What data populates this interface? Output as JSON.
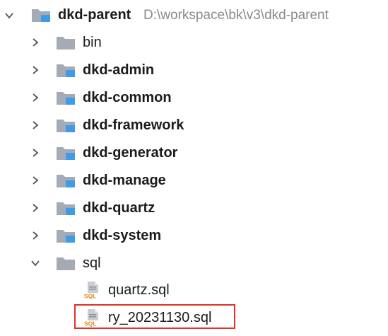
{
  "root": {
    "name": "dkd-parent",
    "path": "D:\\workspace\\bk\\v3\\dkd-parent"
  },
  "items": [
    {
      "label": "bin"
    },
    {
      "label": "dkd-admin"
    },
    {
      "label": "dkd-common"
    },
    {
      "label": "dkd-framework"
    },
    {
      "label": "dkd-generator"
    },
    {
      "label": "dkd-manage"
    },
    {
      "label": "dkd-quartz"
    },
    {
      "label": "dkd-system"
    },
    {
      "label": "sql"
    }
  ],
  "sql_files": [
    {
      "label": "quartz.sql",
      "icon_text": "SQL"
    },
    {
      "label": "ry_20231130.sql",
      "icon_text": "SQL"
    }
  ],
  "colors": {
    "module_blue": "#3d9bea",
    "folder_gray": "#a5abb4",
    "highlight_red": "#e0312b",
    "sql_orange": "#e0891a"
  }
}
